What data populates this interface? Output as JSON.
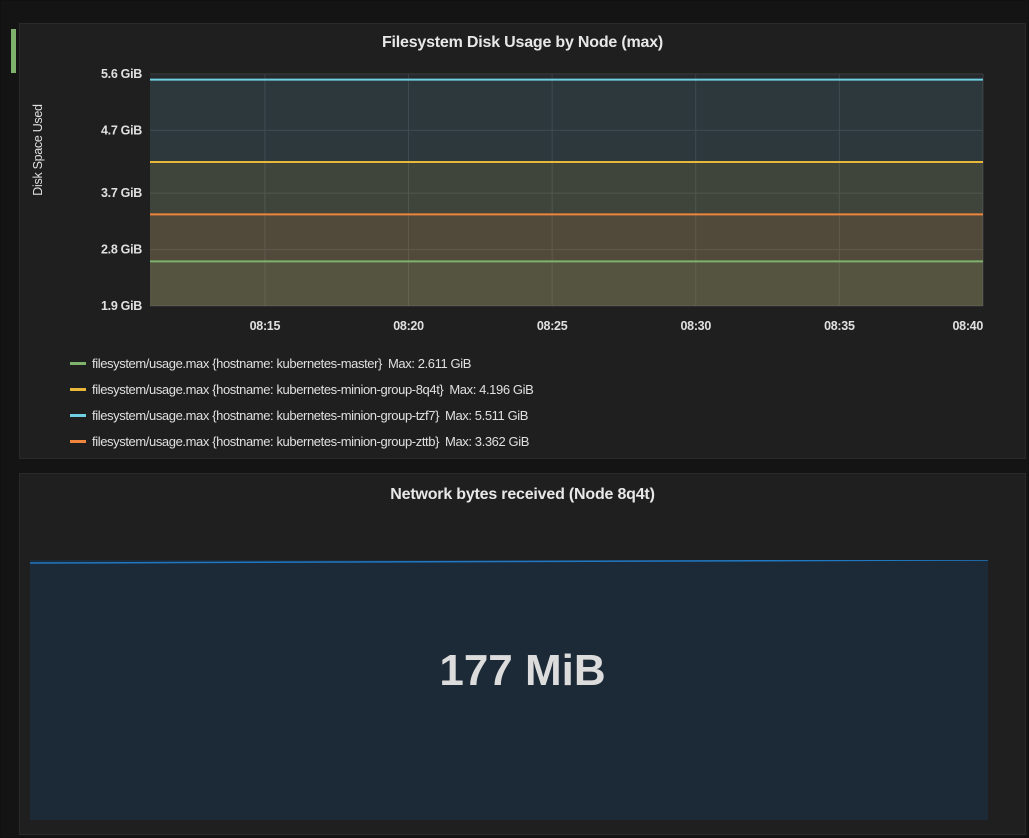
{
  "panels": {
    "disk": {
      "title": "Filesystem Disk Usage by Node (max)",
      "accent_color": "#7eb26d"
    },
    "network": {
      "title": "Network bytes received (Node 8q4t)",
      "value": "177 MiB",
      "line_color": "#1f78c1",
      "fill_color": "#1c2937"
    }
  },
  "chart_data": [
    {
      "type": "line",
      "title": "Filesystem Disk Usage by Node (max)",
      "ylabel": "Disk Space Used",
      "xlabel": "",
      "x_ticks": [
        "08:15",
        "08:20",
        "08:25",
        "08:30",
        "08:35",
        "08:40"
      ],
      "xlim": [
        "08:11",
        "08:40"
      ],
      "y_ticks": [
        "1.9 GiB",
        "2.8 GiB",
        "3.7 GiB",
        "4.7 GiB",
        "5.6 GiB"
      ],
      "ylim": [
        1.9,
        5.6
      ],
      "grid": true,
      "legend_position": "bottom",
      "fill": true,
      "series": [
        {
          "name": "filesystem/usage.max {hostname: kubernetes-master}",
          "legend_value": "Max: 2.611 GiB",
          "color": "#7eb26d",
          "x": [
            "08:11",
            "08:40"
          ],
          "values": [
            2.611,
            2.611
          ]
        },
        {
          "name": "filesystem/usage.max {hostname: kubernetes-minion-group-8q4t}",
          "legend_value": "Max: 4.196 GiB",
          "color": "#eab839",
          "x": [
            "08:11",
            "08:40"
          ],
          "values": [
            4.196,
            4.196
          ]
        },
        {
          "name": "filesystem/usage.max {hostname: kubernetes-minion-group-tzf7}",
          "legend_value": "Max: 5.511 GiB",
          "color": "#6ed0e0",
          "x": [
            "08:11",
            "08:40"
          ],
          "values": [
            5.511,
            5.511
          ]
        },
        {
          "name": "filesystem/usage.max {hostname: kubernetes-minion-group-zttb}",
          "legend_value": "Max: 3.362 GiB",
          "color": "#ef843c",
          "x": [
            "08:11",
            "08:40"
          ],
          "values": [
            3.362,
            3.362
          ]
        }
      ]
    }
  ]
}
